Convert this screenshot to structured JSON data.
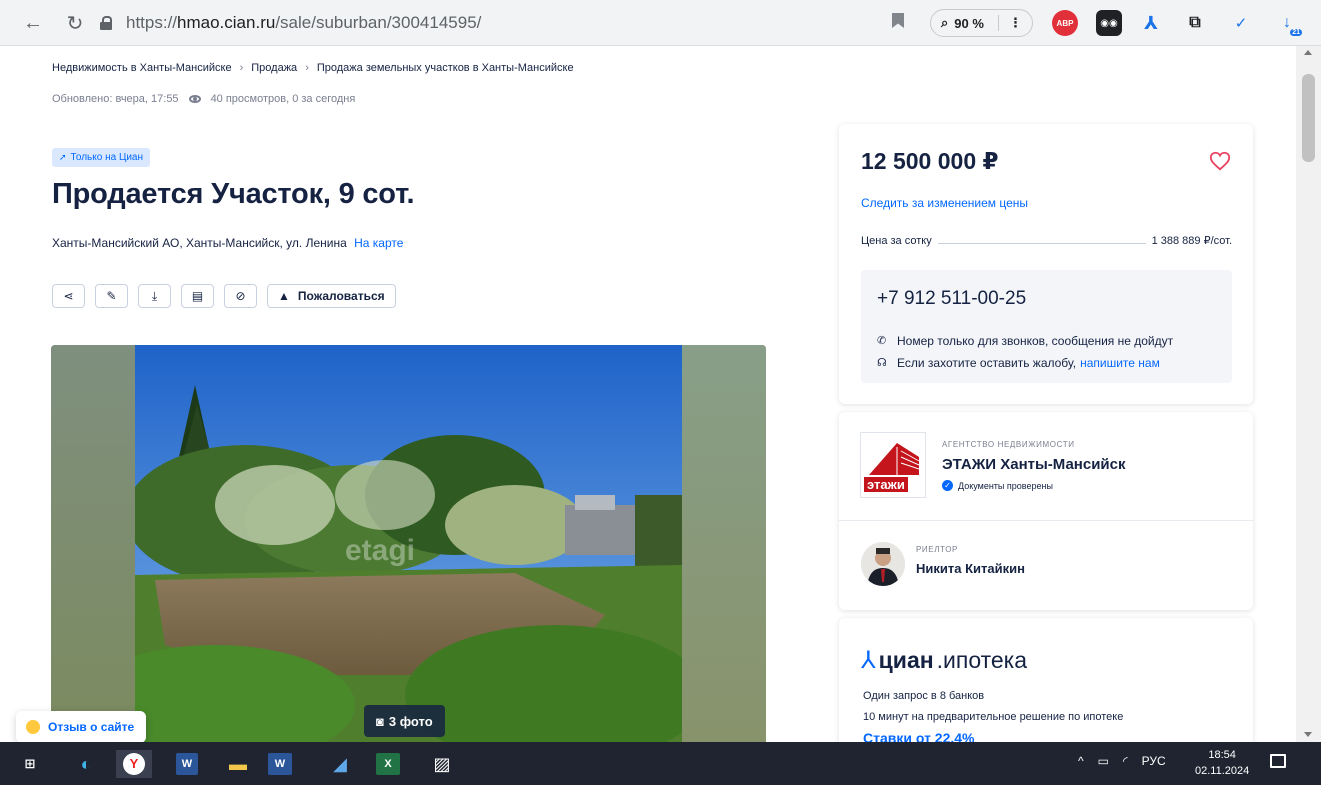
{
  "browser": {
    "url_prefix": "https://",
    "url_domain": "hmao.cian.ru",
    "url_path": "/sale/suburban/300414595/",
    "zoom": "90 %",
    "ext_abp": "ABP",
    "ext_badge": "21"
  },
  "breadcrumbs": [
    "Недвижимость в Ханты-Мансийске",
    "Продажа",
    "Продажа земельных участков в Ханты-Мансийске"
  ],
  "meta": {
    "updated": "Обновлено: вчера, 17:55",
    "views": "40 просмотров, 0 за сегодня"
  },
  "badge": "Только на Циан",
  "title": "Продается Участок, 9 сот.",
  "address": {
    "text": "Ханты-Мансийский АО, Ханты-Мансийск, ул. Ленина",
    "map_link": "На карте"
  },
  "actions": {
    "complain": "Пожаловаться"
  },
  "gallery": {
    "photo_count": "3 фото",
    "watermark": "etagi"
  },
  "feedback": "Отзыв о сайте",
  "price_card": {
    "price": "12 500 000 ₽",
    "track": "Следить за изменением цены",
    "per_sotka_label": "Цена за сотку",
    "per_sotka_value": "1 388 889 ₽/сот.",
    "phone": "+7 912 511-00-25",
    "note_calls": "Номер только для звонков, сообщения не дойдут",
    "note_complaint": "Если захотите оставить жалобу,",
    "note_complaint_link": "напишите нам"
  },
  "agent": {
    "logo_text": "этажи",
    "caption": "АГЕНТСТВО НЕДВИЖИМОСТИ",
    "name": "ЭТАЖИ Ханты-Мансийск",
    "verified": "Документы проверены",
    "realtor_caption": "РИЕЛТОР",
    "realtor_name": "Никита Китайкин"
  },
  "mortgage": {
    "logo_bold": "циан",
    "logo_light": ".ипотека",
    "line1": "Один запрос в 8 банков",
    "line2": "10 минут на предварительное решение по ипотеке",
    "rates": "Ставки от 22,4%"
  },
  "taskbar": {
    "lang": "РУС",
    "time": "18:54",
    "date": "02.11.2024"
  },
  "colors": {
    "accent": "#0468ff",
    "text": "#152242",
    "heart": "#e84260",
    "brand_red": "#c4141c"
  }
}
